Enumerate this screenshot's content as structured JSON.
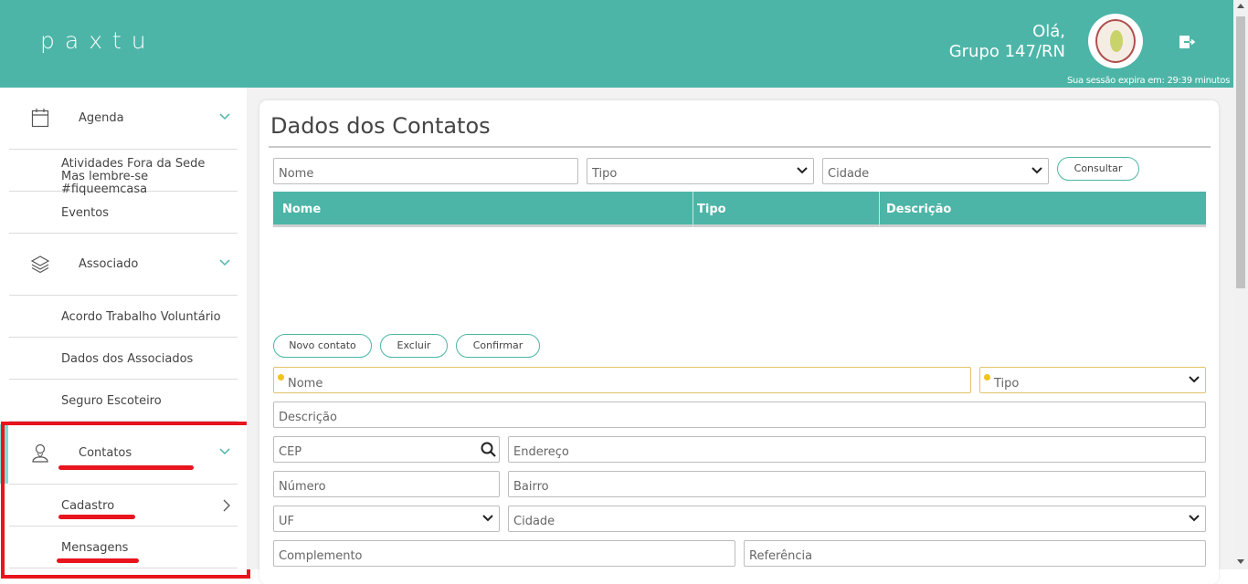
{
  "header": {
    "logo": "paxtu",
    "greeting_line1": "Olá,",
    "greeting_line2": "Grupo 147/RN",
    "session_text": "Sua sessão expira em: 29:39 minutos"
  },
  "sidebar": {
    "groups": [
      {
        "label": "Agenda",
        "icon": "calendar-icon"
      },
      {
        "label": "Associado",
        "icon": "layers-icon"
      },
      {
        "label": "Contatos",
        "icon": "person-icon"
      }
    ],
    "agenda_items": [
      {
        "label_line1": "Atividades Fora da Sede",
        "label_line2": "Mas lembre-se #fiqueemcasa"
      },
      {
        "label": "Eventos"
      }
    ],
    "associado_items": [
      {
        "label": "Acordo Trabalho Voluntário"
      },
      {
        "label": "Dados dos Associados"
      },
      {
        "label": "Seguro Escoteiro"
      }
    ],
    "contatos_items": [
      {
        "label": "Cadastro"
      },
      {
        "label": "Mensagens"
      }
    ]
  },
  "main": {
    "title": "Dados dos Contatos",
    "filters": {
      "nome_placeholder": "Nome",
      "tipo_value": "Tipo",
      "cidade_value": "Cidade",
      "consultar_label": "Consultar"
    },
    "table": {
      "columns": [
        "Nome",
        "Tipo",
        "Descrição"
      ],
      "rows": []
    },
    "actions": {
      "novo_label": "Novo contato",
      "excluir_label": "Excluir",
      "confirmar_label": "Confirmar"
    },
    "form": {
      "nome": "Nome",
      "tipo": "Tipo",
      "descricao": "Descrição",
      "cep": "CEP",
      "endereco": "Endereço",
      "numero": "Número",
      "bairro": "Bairro",
      "uf": "UF",
      "cidade": "Cidade",
      "complemento": "Complemento",
      "referencia": "Referência"
    }
  },
  "colors": {
    "accent": "#4db5a7",
    "highlight": "#e8141e",
    "active_bar": "#7ee0d6",
    "required": "#f0c419"
  }
}
